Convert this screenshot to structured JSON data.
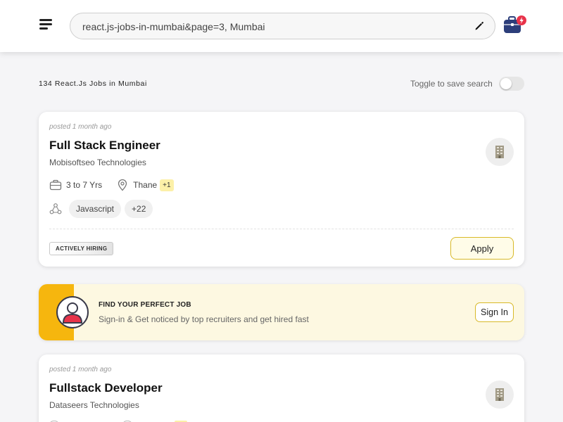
{
  "search": {
    "query": "react.js-jobs-in-mumbai&page=3, Mumbai"
  },
  "results": {
    "count_text": "134 React.Js Jobs in Mumbai",
    "toggle_label": "Toggle to save search",
    "toggle_on": false
  },
  "jobs": [
    {
      "posted": "posted 1 month ago",
      "title": "Full Stack Engineer",
      "company": "Mobisoftseo Technologies",
      "experience": "3 to 7 Yrs",
      "location": "Thane",
      "location_extra": "+1",
      "skills": [
        "Javascript",
        "+22"
      ],
      "badge": "ACTIVELY HIRING",
      "apply_label": "Apply"
    },
    {
      "posted": "posted 1 month ago",
      "title": "Fullstack Developer",
      "company": "Dataseers Technologies"
    }
  ],
  "promo": {
    "title": "FIND YOUR PERFECT JOB",
    "subtitle": "Sign-in & Get noticed by top recruiters and get hired fast",
    "button": "Sign In"
  },
  "colors": {
    "accent_yellow": "#f6b60e",
    "apply_border": "#d8b928",
    "badge_red": "#e8334a",
    "bag_navy": "#2c3e7a"
  },
  "icons": {
    "menu": "hamburger-menu-icon",
    "edit": "pencil-icon",
    "bag": "briefcase-notification-icon",
    "experience": "briefcase-icon",
    "location": "location-pin-icon",
    "skills": "skills-network-icon",
    "company_logo": "building-icon",
    "avatar": "user-avatar-icon"
  }
}
